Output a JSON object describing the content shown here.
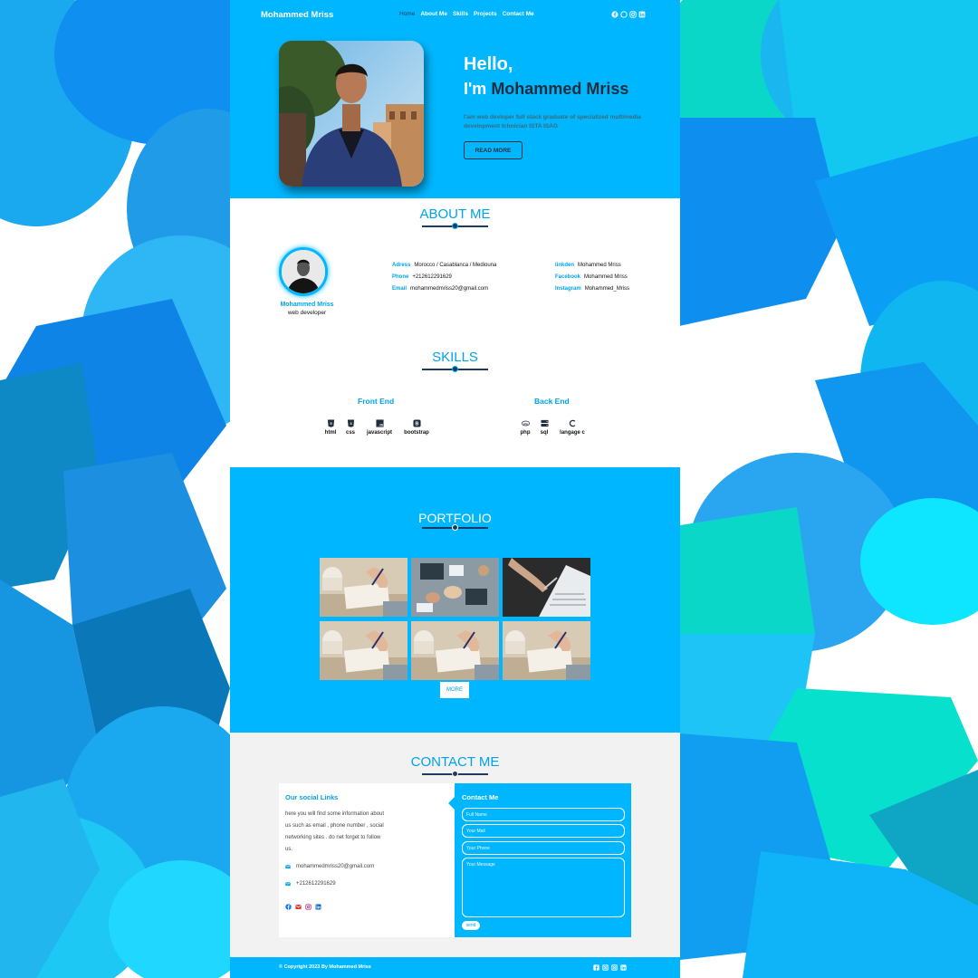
{
  "header": {
    "brand": "Mohammed Mriss",
    "nav": [
      "Home",
      "About Me",
      "Skills",
      "Projects",
      "Contact Me"
    ],
    "active_nav": "Home",
    "social_icons": [
      "facebook-icon",
      "whatsapp-icon",
      "instagram-icon",
      "linkedin-icon"
    ]
  },
  "hero": {
    "hello": "Hello,",
    "im_prefix": "I'm",
    "name": "Mohammed Mriss",
    "tagline": "I'am web devloper full stack graduate of specialized multimedia development tchnician ISTA ISAG",
    "button": "READ MORE"
  },
  "about": {
    "title": "ABOUT ME",
    "name": "Mohammed Mriss",
    "role": "web developer",
    "info_left": [
      {
        "key": "Adress",
        "value": "Morocco / Casablanca / Mediouna"
      },
      {
        "key": "Phone",
        "value": "+212612291629"
      },
      {
        "key": "Email",
        "value": "mohammedmriss20@gmail.com"
      }
    ],
    "info_right": [
      {
        "key": "linkden",
        "value": "Mohammed Mriss"
      },
      {
        "key": "Facebook",
        "value": "Mohammed Mriss"
      },
      {
        "key": "Instagram",
        "value": "Mohammed_Mriss"
      }
    ]
  },
  "skills": {
    "title": "SKILLS",
    "front_title": "Front End",
    "back_title": "Back End",
    "front": [
      {
        "label": "html",
        "icon": "html5-icon"
      },
      {
        "label": "css",
        "icon": "css3-icon"
      },
      {
        "label": "javascript",
        "icon": "javascript-icon"
      },
      {
        "label": "bootstrap",
        "icon": "bootstrap-icon"
      }
    ],
    "back": [
      {
        "label": "php",
        "icon": "php-icon"
      },
      {
        "label": "sql",
        "icon": "database-icon"
      },
      {
        "label": "langage c",
        "icon": "c-language-icon"
      }
    ]
  },
  "portfolio": {
    "title": "PORTFOLIO",
    "more": "MORE",
    "images": [
      "notebook-writing",
      "team-desk-overhead",
      "document-review",
      "notebook-writing",
      "notebook-writing",
      "notebook-writing"
    ]
  },
  "contact": {
    "title": "CONTACT ME",
    "social_title": "Our social Links",
    "social_text": "here you will find some information about us such as email , phone number , social networking sites . do net forget to follow us.",
    "email": "mohammedmriss20@gmail.com",
    "phone": "+212612291629",
    "social_icons": [
      "facebook-icon",
      "mail-icon",
      "instagram-icon",
      "linkedin-icon"
    ],
    "form_title": "Contact Me",
    "ph_name": "Full Name",
    "ph_mail": "Your Mail",
    "ph_phone": "Your Phone",
    "ph_message": "Your Message",
    "send": "send"
  },
  "footer": {
    "copyright": "© Copyright 2023 By Mohammed Mriss",
    "icons": [
      "facebook-icon",
      "instagram-icon",
      "instagram-icon",
      "linkedin-icon"
    ]
  },
  "colors": {
    "primary": "#00b7ff",
    "accent_text": "#00a3e8",
    "dark": "#1f2d3d",
    "contact_bg": "#f2f2f2"
  }
}
